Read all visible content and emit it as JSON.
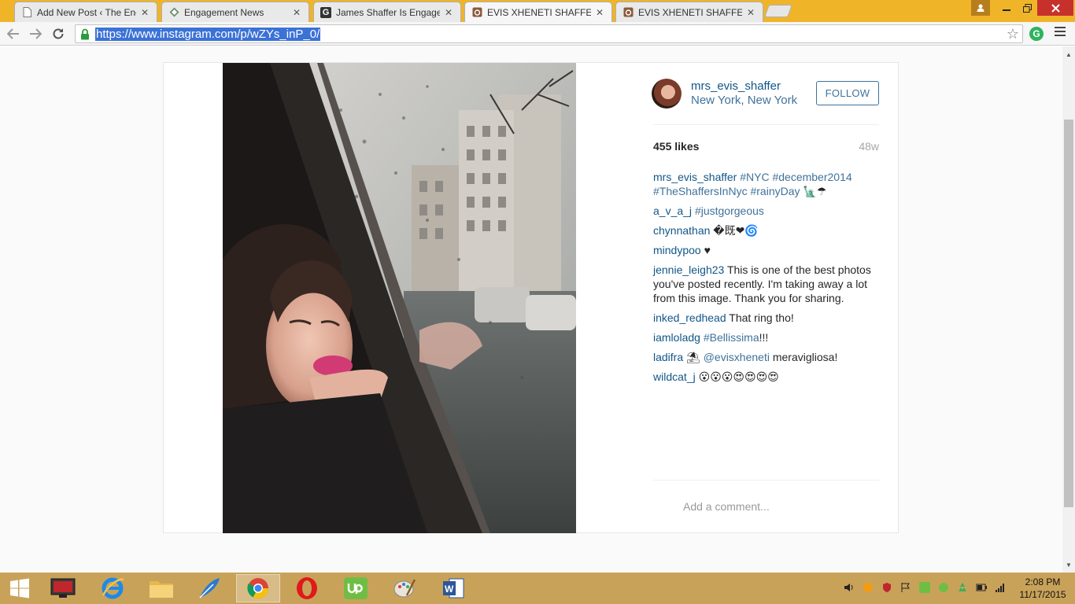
{
  "browser": {
    "tabs": [
      {
        "title": "Add New Post ‹ The Engag",
        "icon": "document-icon",
        "active": false
      },
      {
        "title": "Engagement News",
        "icon": "diamond-icon",
        "active": false
      },
      {
        "title": "James Shaffer Is Engaged",
        "icon": "g-letter-icon",
        "active": false
      },
      {
        "title": "EVIS XHENETI SHAFFER o",
        "icon": "instagram-icon",
        "active": true
      },
      {
        "title": "EVIS XHENETI SHAFFER o",
        "icon": "instagram-icon",
        "active": false
      }
    ],
    "close_glyph": "✕",
    "url": "https://www.instagram.com/p/wZYs_inP_0/"
  },
  "post": {
    "username": "mrs_evis_shaffer",
    "location": "New York, New York",
    "follow_label": "FOLLOW",
    "likes": "455 likes",
    "age": "48w",
    "caption": {
      "user": "mrs_evis_shaffer",
      "text": "#NYC #december2014 #TheShaffersInNyc #rainyDay",
      "emoji": "🗽☂"
    },
    "comments": [
      {
        "user": "a_v_a_j",
        "tag": "#justgorgeous",
        "text": ""
      },
      {
        "user": "chynnathan",
        "tag": "",
        "text": "�既❤🌀"
      },
      {
        "user": "mindypoo",
        "tag": "",
        "text": "♥"
      },
      {
        "user": "jennie_leigh23",
        "tag": "",
        "text": "This is one of the best photos you've posted recently. I'm taking away a lot from this image. Thank you for sharing."
      },
      {
        "user": "inked_redhead",
        "tag": "",
        "text": "That ring tho!"
      },
      {
        "user": "iamloladg",
        "tag": "#Bellissima",
        "text": "!!!"
      },
      {
        "user": "ladifra",
        "tag": "@evisxheneti",
        "text": "meravigliosa!",
        "prefix": "⛱"
      },
      {
        "user": "wildcat_j",
        "tag": "",
        "text": "😮😮😮😍😍😍😍"
      }
    ],
    "add_comment_placeholder": "Add a comment..."
  },
  "taskbar": {
    "apps": [
      "windows-start-icon",
      "remote-desktop-icon",
      "internet-explorer-icon",
      "file-explorer-icon",
      "feather-app-icon",
      "chrome-icon",
      "opera-icon",
      "upwork-icon",
      "paint-icon",
      "word-icon"
    ],
    "clock_time": "2:08 PM",
    "clock_date": "11/17/2015"
  },
  "colors": {
    "titlebar": "#f0b429",
    "taskbar": "#c9a25a",
    "ig_blue": "#125688",
    "ig_link": "#3f729b"
  }
}
